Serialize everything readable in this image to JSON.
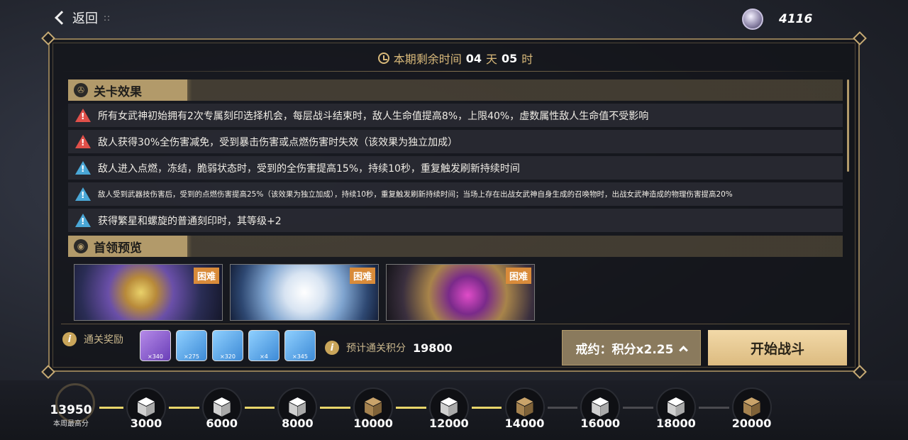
{
  "header": {
    "back_label": "返回",
    "currency_icon": "crystal-coin-icon",
    "currency_value": "4116"
  },
  "timer": {
    "prefix": "本期剩余时间",
    "days": "04",
    "day_unit": "天",
    "hours": "05",
    "hour_unit": "时"
  },
  "stage_effects": {
    "title": "关卡效果",
    "items": [
      {
        "level": "red",
        "text": "所有女武神初始拥有2次专属刻印选择机会，每层战斗结束时，敌人生命值提高8%，上限40%，虚数属性敌人生命值不受影响"
      },
      {
        "level": "red",
        "text": "敌人获得30%全伤害减免，受到暴击伤害或点燃伤害时失效（该效果为独立加成）"
      },
      {
        "level": "blue",
        "text": "敌人进入点燃，冻结，脆弱状态时，受到的全伤害提高15%，持续10秒，重复触发刷新持续时间"
      },
      {
        "level": "blue",
        "text": "敌人受到武器技伤害后，受到的点燃伤害提高25%（该效果为独立加成），持续10秒，重复触发刷新持续时间；当场上存在出战女武神自身生成的召唤物时，出战女武神造成的物理伤害提高20%"
      },
      {
        "level": "blue",
        "text": "获得繁星和螺旋的普通刻印时，其等级+2"
      }
    ]
  },
  "boss_preview": {
    "title": "首领预览",
    "bosses": [
      {
        "difficulty": "困难"
      },
      {
        "difficulty": "困难"
      },
      {
        "difficulty": "困难"
      }
    ]
  },
  "rewards": {
    "label": "通关奖励",
    "items": [
      {
        "icon": "valkyrie-fragment-icon",
        "qty": "×340",
        "color": "#8a5bd6"
      },
      {
        "icon": "rainbow-disc-icon",
        "qty": "×275",
        "color": "#4e9ee0"
      },
      {
        "icon": "avatar-fragment-icon",
        "qty": "×320",
        "color": "#4e9ee0"
      },
      {
        "icon": "flower-material-icon",
        "qty": "×4",
        "color": "#4e9ee0"
      },
      {
        "icon": "crystal-diamond-icon",
        "qty": "×345",
        "color": "#4e9ee0"
      }
    ],
    "score_label": "预计通关积分",
    "score_value": "19800"
  },
  "actions": {
    "pact_label": "戒约：积分x2.25",
    "start_label": "开始战斗"
  },
  "progress": {
    "best_value": "13950",
    "best_caption": "本周最高分",
    "milestones": [
      {
        "value": "3000",
        "reached": true
      },
      {
        "value": "6000",
        "reached": true
      },
      {
        "value": "8000",
        "reached": true
      },
      {
        "value": "10000",
        "reached": false
      },
      {
        "value": "12000",
        "reached": true
      },
      {
        "value": "14000",
        "reached": false
      },
      {
        "value": "16000",
        "reached": true
      },
      {
        "value": "18000",
        "reached": true
      },
      {
        "value": "20000",
        "reached": false
      }
    ]
  }
}
